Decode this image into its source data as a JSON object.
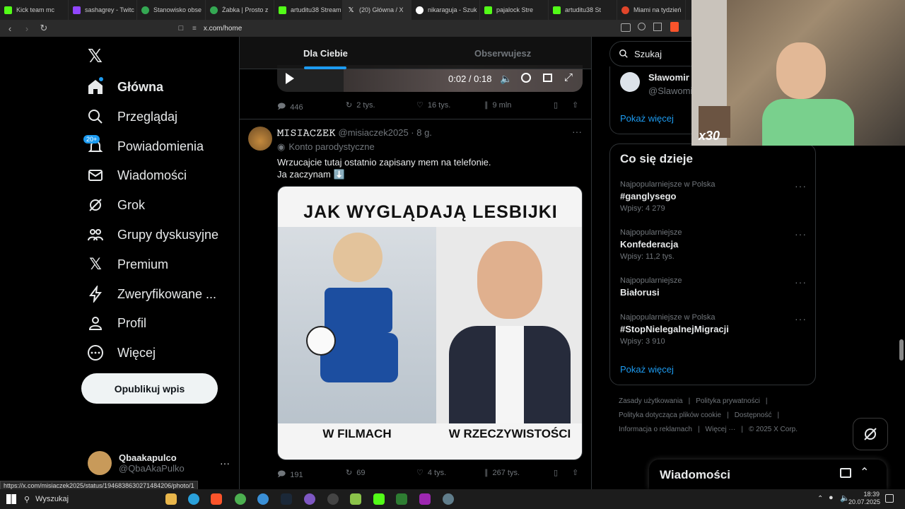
{
  "browser": {
    "tabs": [
      "Kick team mc",
      "sashagrey - Twitc",
      "Stanowisko obse",
      "Żabka | Prosto z",
      "artuditu38 Stream",
      "(20) Główna / X",
      "nikaraguja - Szuk",
      "pajalock Stre",
      "artuditu38 St",
      "Miami na tydzień",
      ""
    ],
    "url": "x.com/home"
  },
  "nav": {
    "items": [
      {
        "label": "Główna",
        "icon": "home-icon"
      },
      {
        "label": "Przeglądaj",
        "icon": "search-icon"
      },
      {
        "label": "Powiadomienia",
        "icon": "bell-icon"
      },
      {
        "label": "Wiadomości",
        "icon": "mail-icon"
      },
      {
        "label": "Grok",
        "icon": "grok-icon"
      },
      {
        "label": "Grupy dyskusyjne",
        "icon": "people-icon"
      },
      {
        "label": "Premium",
        "icon": "x-logo-icon"
      },
      {
        "label": "Zweryfikowane ...",
        "icon": "lightning-icon"
      },
      {
        "label": "Profil",
        "icon": "person-icon"
      },
      {
        "label": "Więcej",
        "icon": "more-circle-icon"
      }
    ],
    "notif_badge": "20+",
    "post_button": "Opublikuj wpis",
    "account_name": "Qbaakapulco",
    "account_handle": "@QbaAkaPulko",
    "more_dots": "···"
  },
  "feed": {
    "tab_for_you": "Dla Ciebie",
    "tab_following": "Obserwujesz",
    "video_time": "0:02 / 0:18",
    "prev_actions": {
      "replies": "446",
      "reposts": "2 tys.",
      "likes": "16 tys.",
      "views": "9 mln"
    },
    "post": {
      "display_name": "𝙼𝙸𝚂𝙸𝙰𝙲𝚉𝙴𝙺",
      "handle_time": "@misiaczek2025 · 8 g.",
      "parody": "Konto parodystyczne",
      "text1": "Wrzucajcie tutaj ostatnio zapisany mem na telefonie.",
      "text2": "Ja zaczynam ⬇️",
      "meme_title": "JAK WYGLĄDAJĄ LESBIJKI",
      "meme_left": "W FILMACH",
      "meme_right": "W RZECZYWISTOŚCI",
      "actions": {
        "replies": "191",
        "reposts": "69",
        "likes": "4 tys.",
        "views": "267 tys."
      }
    }
  },
  "right": {
    "search_placeholder": "Szukaj",
    "suggest_name": "Sławomir M",
    "suggest_handle": "@Slawomi",
    "show_more": "Pokaż więcej",
    "trends_title": "Co się dzieje",
    "trends": [
      {
        "category": "Najpopularniejsze w Polska",
        "name": "#ganglysego",
        "count": "Wpisy: 4 279"
      },
      {
        "category": "Najpopularniejsze",
        "name": "Konfederacja",
        "count": "Wpisy: 11,2 tys."
      },
      {
        "category": "Najpopularniejsze",
        "name": "Białorusi",
        "count": ""
      },
      {
        "category": "Najpopularniejsze w Polska",
        "name": "#StopNielegalnejMigracji",
        "count": "Wpisy: 3 910"
      }
    ],
    "show_more2": "Pokaż więcej",
    "footer": {
      "l1a": "Zasady użytkowania",
      "l1b": "Polityka prywatności",
      "l2a": "Polityka dotycząca plików cookie",
      "l2b": "Dostępność",
      "l3a": "Informacja o reklamach",
      "l3b": "Więcej ···",
      "l3c": "© 2025 X Corp."
    },
    "messages_title": "Wiadomości"
  },
  "overlay": {
    "x30": "x30"
  },
  "status_url": "https://x.com/misiaczek2025/status/1946838630271484206/photo/1",
  "taskbar": {
    "search": "Wyszukaj",
    "time": "18:39",
    "date": "20.07.2025"
  }
}
